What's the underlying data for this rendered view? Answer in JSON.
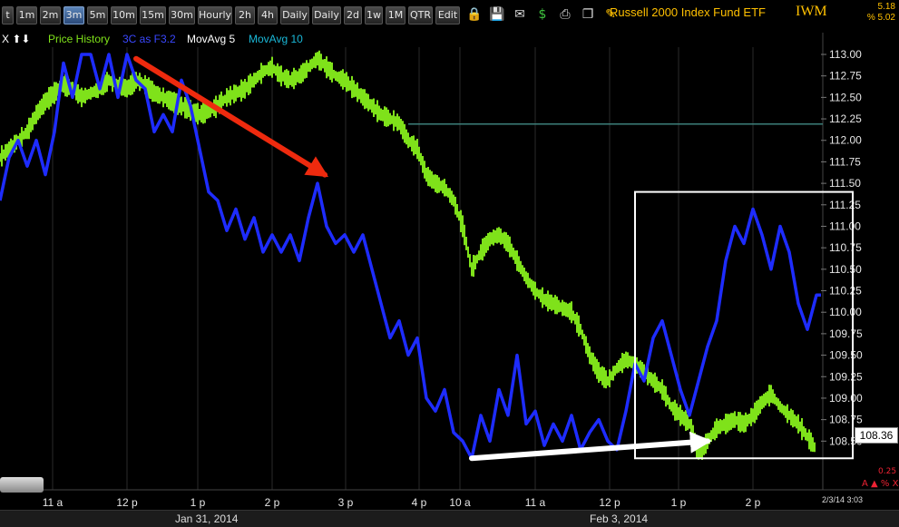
{
  "toolbar": {
    "tabs": [
      "t",
      "1m",
      "2m",
      "3m",
      "5m",
      "10m",
      "15m",
      "30m",
      "Hourly",
      "2h",
      "4h",
      "Daily",
      "Daily",
      "2d",
      "1w",
      "1M",
      "QTR",
      "Edit"
    ],
    "active_tab": "3m",
    "icons": [
      "lock-icon",
      "save-icon",
      "email-icon",
      "dollar-icon",
      "print-icon",
      "copy-icon",
      "pencil-icon"
    ],
    "title": "Russell 2000 Index Fund ETF",
    "symbol": "IWM",
    "change_abs": "5.18",
    "change_pct": "% 5.02"
  },
  "legend": {
    "controls": "X ⬆⬇",
    "price_history": "Price History",
    "indicator": "3C as F3.2",
    "ma5": "MovAvg 5",
    "ma10": "MovAvg 10"
  },
  "colors": {
    "price": "#7fe21a",
    "indicator": "#1e2cff",
    "arrow_red": "#ee2a0e",
    "arrow_white": "#ffffff",
    "box": "#ffffff",
    "hline": "#3d7f7a",
    "accent": "#ffc000"
  },
  "chart_data": {
    "type": "line",
    "title": "Russell 2000 Index Fund ETF",
    "x_tick_labels": [
      "11 a",
      "12 p",
      "1 p",
      "2 p",
      "3 p",
      "4 p",
      "10 a",
      "11 a",
      "12 p",
      "1 p",
      "2 p"
    ],
    "date_labels": [
      "Jan 31, 2014",
      "Feb 3, 2014"
    ],
    "ylim": [
      108.25,
      113.0
    ],
    "y_ticks": [
      "113.00",
      "112.75",
      "112.50",
      "112.25",
      "112.00",
      "111.75",
      "111.50",
      "111.25",
      "111.00",
      "110.75",
      "110.50",
      "110.25",
      "110.00",
      "109.75",
      "109.50",
      "109.25",
      "109.00",
      "108.75",
      "108.50"
    ],
    "last_price": "108.36",
    "horizontal_line": 112.19,
    "lower_pane_value": "0.25",
    "lower_pane_icons": "A ▲ % X",
    "timestamp": "2/3/14 3:03",
    "series": [
      {
        "name": "Price History",
        "x": [
          0,
          10,
          20,
          30,
          40,
          50,
          60,
          70,
          80,
          90,
          100,
          110,
          120,
          130,
          140,
          150,
          160,
          170,
          180,
          190,
          200,
          210,
          220,
          230,
          240,
          250,
          260,
          270,
          280,
          290,
          300,
          310,
          320,
          330,
          340,
          350,
          360,
          370,
          380,
          390,
          400,
          410,
          420,
          430,
          440,
          450,
          460,
          470,
          480,
          490,
          500,
          510,
          520,
          530,
          540,
          550,
          560,
          570,
          580,
          590,
          600,
          610,
          620,
          630,
          640,
          650,
          660,
          670,
          680,
          690,
          700,
          710,
          720,
          730,
          740,
          750,
          760,
          770,
          780,
          790,
          800,
          810,
          820,
          830,
          840,
          850,
          860,
          870,
          880,
          890,
          900
        ],
        "y": [
          111.8,
          111.9,
          112.0,
          112.1,
          112.3,
          112.45,
          112.55,
          112.65,
          112.6,
          112.5,
          112.55,
          112.6,
          112.7,
          112.65,
          112.6,
          112.7,
          112.65,
          112.55,
          112.5,
          112.45,
          112.4,
          112.35,
          112.3,
          112.35,
          112.4,
          112.5,
          112.55,
          112.6,
          112.7,
          112.8,
          112.85,
          112.75,
          112.7,
          112.75,
          112.85,
          112.95,
          112.85,
          112.75,
          112.7,
          112.6,
          112.5,
          112.4,
          112.3,
          112.25,
          112.2,
          112.0,
          111.9,
          111.6,
          111.5,
          111.45,
          111.3,
          111.0,
          110.5,
          110.7,
          110.85,
          110.9,
          110.8,
          110.6,
          110.4,
          110.25,
          110.15,
          110.1,
          110.05,
          110.0,
          109.8,
          109.5,
          109.3,
          109.2,
          109.35,
          109.45,
          109.4,
          109.3,
          109.2,
          109.1,
          108.9,
          108.8,
          108.7,
          108.35,
          108.5,
          108.65,
          108.7,
          108.75,
          108.7,
          108.8,
          108.95,
          109.05,
          108.9,
          108.8,
          108.7,
          108.55,
          108.4
        ]
      },
      {
        "name": "3C as F3.2",
        "x": [
          0,
          10,
          20,
          30,
          40,
          50,
          60,
          70,
          80,
          90,
          100,
          110,
          120,
          130,
          140,
          150,
          160,
          170,
          180,
          190,
          200,
          210,
          220,
          230,
          240,
          250,
          260,
          270,
          280,
          290,
          300,
          310,
          320,
          330,
          340,
          350,
          360,
          370,
          380,
          390,
          400,
          410,
          420,
          430,
          440,
          450,
          460,
          470,
          480,
          490,
          500,
          510,
          520,
          530,
          540,
          550,
          560,
          570,
          580,
          590,
          600,
          610,
          620,
          630,
          640,
          650,
          660,
          670,
          680,
          690,
          700,
          710,
          720,
          730,
          740,
          750,
          760,
          770,
          780,
          790,
          800,
          810,
          820,
          830,
          840,
          850,
          860,
          870,
          880,
          890,
          900,
          905
        ],
        "y": [
          111.3,
          111.8,
          112.0,
          111.7,
          112.0,
          111.6,
          112.1,
          112.9,
          112.5,
          113.0,
          113.0,
          112.6,
          113.0,
          112.5,
          113.0,
          112.7,
          112.6,
          112.1,
          112.3,
          112.1,
          112.7,
          112.4,
          111.9,
          111.4,
          111.3,
          110.95,
          111.2,
          110.85,
          111.1,
          110.7,
          110.9,
          110.7,
          110.9,
          110.6,
          111.1,
          111.5,
          111.0,
          110.8,
          110.9,
          110.7,
          110.9,
          110.5,
          110.1,
          109.7,
          109.9,
          109.5,
          109.7,
          109.0,
          108.85,
          109.1,
          108.6,
          108.5,
          108.3,
          108.8,
          108.5,
          109.1,
          108.8,
          109.5,
          108.7,
          108.85,
          108.45,
          108.7,
          108.5,
          108.8,
          108.4,
          108.6,
          108.75,
          108.5,
          108.4,
          108.85,
          109.4,
          109.2,
          109.7,
          109.9,
          109.5,
          109.1,
          108.8,
          109.2,
          109.6,
          109.9,
          110.6,
          111.0,
          110.8,
          111.2,
          110.9,
          110.5,
          111.0,
          110.7,
          110.1,
          109.8,
          110.2,
          110.2
        ]
      }
    ],
    "annotations": [
      {
        "type": "arrow",
        "color": "red",
        "from": [
          150,
          112.95
        ],
        "to": [
          358,
          111.6
        ]
      },
      {
        "type": "arrow",
        "color": "white",
        "from": [
          520,
          108.3
        ],
        "to": [
          780,
          108.5
        ]
      },
      {
        "type": "rectangle",
        "color": "white",
        "x": [
          700,
          940
        ],
        "y": [
          108.3,
          111.4
        ]
      }
    ]
  }
}
